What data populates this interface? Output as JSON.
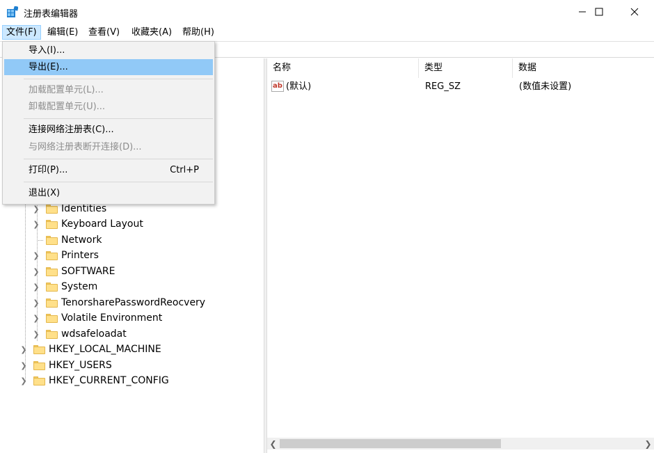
{
  "window": {
    "title": "注册表编辑器",
    "app_icon": "regedit-icon",
    "buttons": [
      "minimize-icon",
      "maximize-icon",
      "close-icon"
    ]
  },
  "menubar": {
    "file": "文件(F)",
    "edit": "编辑(E)",
    "view": "查看(V)",
    "favorites": "收藏夹(A)",
    "help": "帮助(H)"
  },
  "file_menu": {
    "import": "导入(I)...",
    "export": "导出(E)...",
    "load_hive": "加载配置单元(L)...",
    "unload_hive": "卸载配置单元(U)...",
    "connect": "连接网络注册表(C)...",
    "disconnect": "与网络注册表断开连接(D)...",
    "print": "打印(P)...",
    "print_shortcut": "Ctrl+P",
    "exit": "退出(X)"
  },
  "tree": {
    "child_keys": [
      "Identities",
      "Keyboard Layout",
      "Network",
      "Printers",
      "SOFTWARE",
      "System",
      "TenorsharePasswordReocvery",
      "Volatile Environment",
      "wdsafeloadat"
    ],
    "root_keys": [
      "HKEY_LOCAL_MACHINE",
      "HKEY_USERS",
      "HKEY_CURRENT_CONFIG"
    ]
  },
  "list": {
    "columns": {
      "name": "名称",
      "type": "类型",
      "data": "数据"
    },
    "rows": [
      {
        "icon": "string-value-icon",
        "icon_text": "ab",
        "name": "(默认)",
        "type": "REG_SZ",
        "data": "(数值未设置)"
      }
    ]
  },
  "colors": {
    "menu_highlight": "#91c9f7",
    "menubar_active": "#cce8ff",
    "folder": "#ffe08a"
  }
}
